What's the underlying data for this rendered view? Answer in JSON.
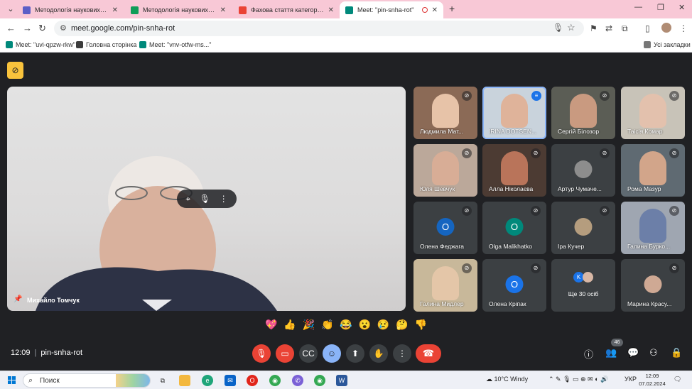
{
  "browser": {
    "tabs": [
      {
        "title": "Методологія наукових досліджень",
        "favicon_color": "#5b5fc7"
      },
      {
        "title": "Методологія наукових досліджень",
        "favicon_color": "#0f9d58"
      },
      {
        "title": "Фахова стаття категорії Б (спец...",
        "favicon_color": "#ea4335"
      },
      {
        "title": "Meet: \"pin-snha-rot\"",
        "favicon_color": "#00897b"
      }
    ],
    "url": "meet.google.com/pin-snha-rot",
    "bookmarks": [
      {
        "label": "Meet: \"uvi-qpzw-rkw\""
      },
      {
        "label": "Головна сторінка"
      },
      {
        "label": "Meet: \"vnv-otfw-ms...\""
      }
    ],
    "all_bookmarks_label": "Усі закладки"
  },
  "meet": {
    "meeting_code": "pin-snha-rot",
    "time": "12:09",
    "main_speaker": "Михайло Томчук",
    "participants": [
      {
        "name": "Людмила Мат...",
        "type": "video",
        "muted": true
      },
      {
        "name": "IRINA DOTSEN...",
        "type": "video",
        "muted": false,
        "speaking": true
      },
      {
        "name": "Сергій Білозор",
        "type": "video",
        "muted": true
      },
      {
        "name": "Таісія Комар",
        "type": "video",
        "muted": true
      },
      {
        "name": "Юля Шевчук",
        "type": "video",
        "muted": true
      },
      {
        "name": "Алла Ніколаєва",
        "type": "video",
        "muted": true
      },
      {
        "name": "Артур Чумаче...",
        "type": "photo",
        "muted": true
      },
      {
        "name": "Рома Мазур",
        "type": "video",
        "muted": true
      },
      {
        "name": "Олена Феджага",
        "type": "letter",
        "letter": "O",
        "color": "#1565c0",
        "muted": true
      },
      {
        "name": "Olga Malikhatko",
        "type": "letter",
        "letter": "O",
        "color": "#00897b",
        "muted": true
      },
      {
        "name": "Іра Кучер",
        "type": "photo",
        "muted": true
      },
      {
        "name": "Галина Бурко...",
        "type": "video",
        "muted": true
      },
      {
        "name": "Галина Мидлер",
        "type": "video",
        "muted": true
      },
      {
        "name": "Олена Кріпак",
        "type": "letter",
        "letter": "O",
        "color": "#1a73e8",
        "muted": true
      },
      {
        "name": "Ще 30 осіб",
        "type": "more"
      },
      {
        "name": "Марина Красу...",
        "type": "photo",
        "muted": true
      }
    ],
    "more_avatar_letter": "K",
    "reactions": [
      "💖",
      "👍",
      "🎉",
      "👏",
      "😂",
      "😮",
      "😢",
      "🤔",
      "👎"
    ],
    "participants_count": "46"
  },
  "taskbar": {
    "search_placeholder": "Поиск",
    "weather": "10°C  Windy",
    "language": "УКР",
    "time": "12:09",
    "date": "07.02.2024"
  }
}
